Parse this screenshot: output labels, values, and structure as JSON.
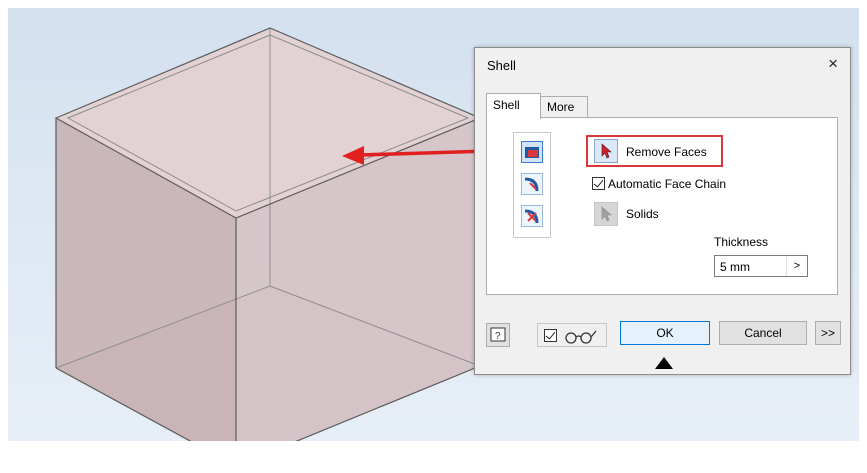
{
  "dialog": {
    "title": "Shell",
    "close_glyph": "×",
    "tabs": [
      {
        "label": "Shell",
        "active": true
      },
      {
        "label": "More",
        "active": false
      }
    ],
    "remove_faces_label": "Remove Faces",
    "automatic_face_chain_label": "Automatic Face Chain",
    "automatic_face_chain_checked": true,
    "solids_label": "Solids",
    "thickness_label": "Thickness",
    "thickness_value": "5 mm",
    "thickness_arrow": ">",
    "direction_buttons": [
      "direction-inside-icon",
      "direction-outside-icon",
      "direction-both-icon"
    ],
    "footer": {
      "help_glyph": "?",
      "preview_checked": true,
      "ok_label": "OK",
      "cancel_label": "Cancel",
      "expand_label": ">>"
    }
  },
  "colors": {
    "viewport_bg": "#d9e5f1",
    "cube_face": "#d9bfc0",
    "cube_edge": "#5a5a5a",
    "highlight_red": "#d9383a",
    "ok_border": "#0078d7"
  },
  "icons": [
    "close-icon",
    "select-arrow-icon",
    "checkbox-icon",
    "help-icon",
    "glasses-icon",
    "expand-triangle-icon",
    "red-arrow"
  ]
}
